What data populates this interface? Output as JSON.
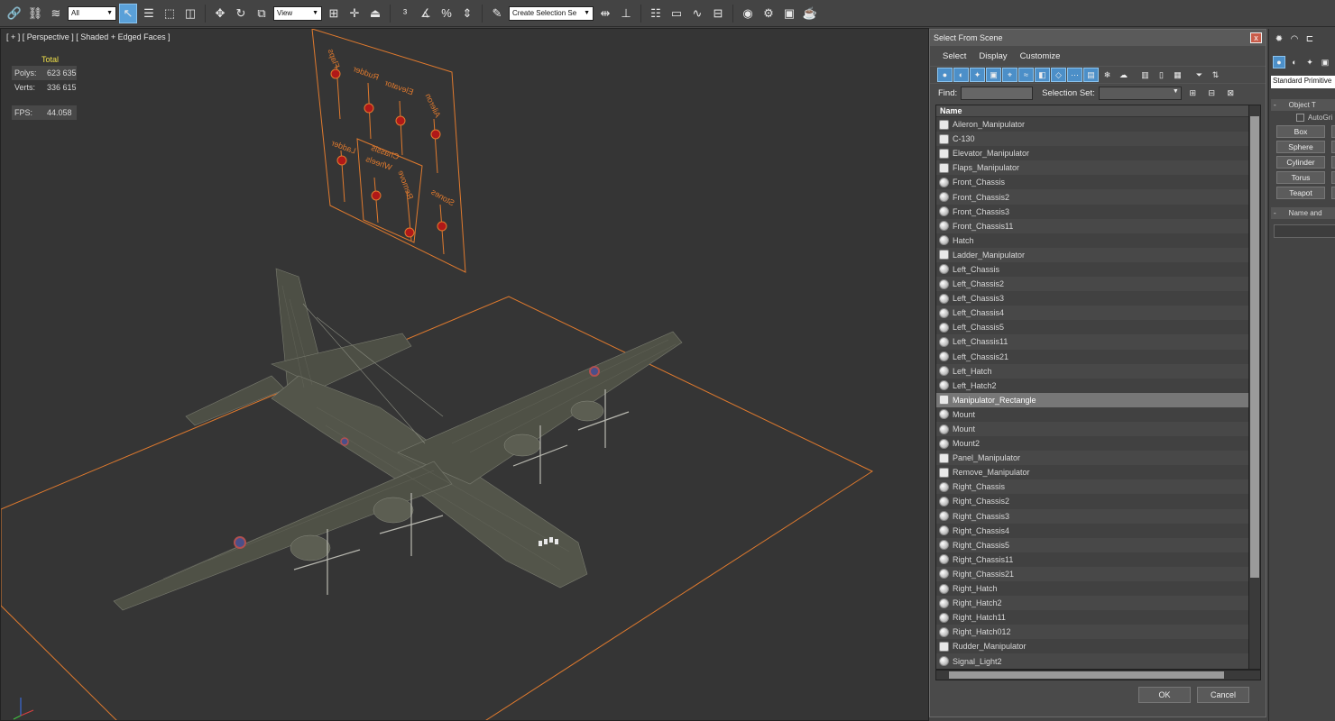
{
  "toolbar": {
    "filter_value": "All",
    "view_value": "View",
    "selection_set_placeholder": "Create Selection Se"
  },
  "viewport": {
    "label": "[ + ] [ Perspective ] [ Shaded + Edged Faces ]",
    "stats": {
      "total_label": "Total",
      "polys_label": "Polys:",
      "polys_value": "623 635",
      "verts_label": "Verts:",
      "verts_value": "336 615",
      "fps_label": "FPS:",
      "fps_value": "44.058"
    },
    "panel_labels": [
      "Flaps",
      "Rudder",
      "Elevator",
      "Aileron",
      "Ladder",
      "Chassis",
      "Wheels",
      "Remove",
      "Stones"
    ]
  },
  "dialog": {
    "title": "Select From Scene",
    "close": "x",
    "menu": [
      "Select",
      "Display",
      "Customize"
    ],
    "find_label": "Find:",
    "selection_set_label": "Selection Set:",
    "column_name": "Name",
    "items": [
      {
        "name": "Aileron_Manipulator",
        "kind": "helper"
      },
      {
        "name": "C-130",
        "kind": "helper"
      },
      {
        "name": "Elevator_Manipulator",
        "kind": "helper"
      },
      {
        "name": "Flaps_Manipulator",
        "kind": "helper"
      },
      {
        "name": "Front_Chassis",
        "kind": "geometry"
      },
      {
        "name": "Front_Chassis2",
        "kind": "geometry"
      },
      {
        "name": "Front_Chassis3",
        "kind": "geometry"
      },
      {
        "name": "Front_Chassis11",
        "kind": "geometry"
      },
      {
        "name": "Hatch",
        "kind": "geometry"
      },
      {
        "name": "Ladder_Manipulator",
        "kind": "helper"
      },
      {
        "name": "Left_Chassis",
        "kind": "geometry"
      },
      {
        "name": "Left_Chassis2",
        "kind": "geometry"
      },
      {
        "name": "Left_Chassis3",
        "kind": "geometry"
      },
      {
        "name": "Left_Chassis4",
        "kind": "geometry"
      },
      {
        "name": "Left_Chassis5",
        "kind": "geometry"
      },
      {
        "name": "Left_Chassis11",
        "kind": "geometry"
      },
      {
        "name": "Left_Chassis21",
        "kind": "geometry"
      },
      {
        "name": "Left_Hatch",
        "kind": "geometry"
      },
      {
        "name": "Left_Hatch2",
        "kind": "geometry"
      },
      {
        "name": "Manipulator_Rectangle",
        "kind": "helper",
        "selected": true
      },
      {
        "name": "Mount",
        "kind": "geometry"
      },
      {
        "name": "Mount",
        "kind": "geometry"
      },
      {
        "name": "Mount2",
        "kind": "geometry"
      },
      {
        "name": "Panel_Manipulator",
        "kind": "helper"
      },
      {
        "name": "Remove_Manipulator",
        "kind": "helper"
      },
      {
        "name": "Right_Chassis",
        "kind": "geometry"
      },
      {
        "name": "Right_Chassis2",
        "kind": "geometry"
      },
      {
        "name": "Right_Chassis3",
        "kind": "geometry"
      },
      {
        "name": "Right_Chassis4",
        "kind": "geometry"
      },
      {
        "name": "Right_Chassis5",
        "kind": "geometry"
      },
      {
        "name": "Right_Chassis11",
        "kind": "geometry"
      },
      {
        "name": "Right_Chassis21",
        "kind": "geometry"
      },
      {
        "name": "Right_Hatch",
        "kind": "geometry"
      },
      {
        "name": "Right_Hatch2",
        "kind": "geometry"
      },
      {
        "name": "Right_Hatch11",
        "kind": "geometry"
      },
      {
        "name": "Right_Hatch012",
        "kind": "geometry"
      },
      {
        "name": "Rudder_Manipulator",
        "kind": "helper"
      },
      {
        "name": "Signal_Light2",
        "kind": "geometry"
      }
    ],
    "ok_label": "OK",
    "cancel_label": "Cancel"
  },
  "command_panel": {
    "category_value": "Standard Primitive",
    "object_type_label": "Object T",
    "autogrid_label": "AutoGri",
    "primitives": [
      "Box",
      "Sphere",
      "Cylinder",
      "Torus",
      "Teapot"
    ],
    "name_color_label": "Name and"
  },
  "colors": {
    "accent": "#4c8fc8",
    "wireframe_orange": "#e07a2e",
    "stats_yellow": "#f0e04a"
  }
}
